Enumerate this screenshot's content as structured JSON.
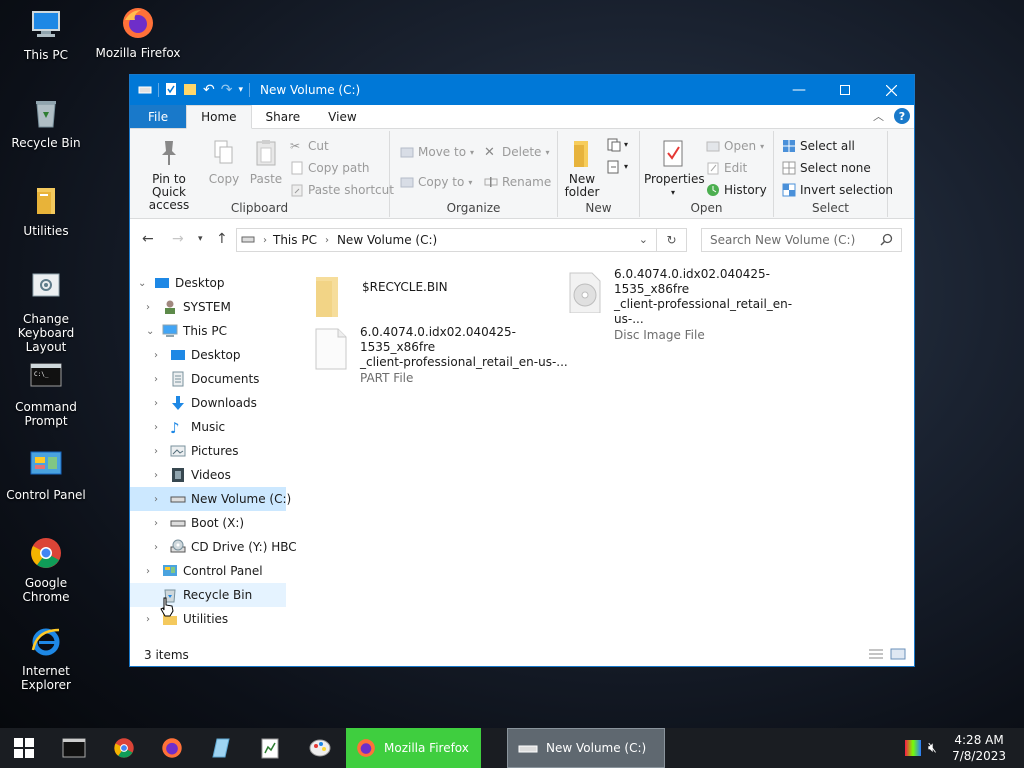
{
  "desktop": {
    "icons": [
      {
        "label": "This PC"
      },
      {
        "label": "Mozilla Firefox"
      },
      {
        "label": "Recycle Bin"
      },
      {
        "label": "Utilities"
      },
      {
        "label_line1": "Change",
        "label_line2": "Keyboard Layout"
      },
      {
        "label_line1": "Command",
        "label_line2": "Prompt"
      },
      {
        "label": "Control Panel"
      },
      {
        "label": "Google Chrome"
      },
      {
        "label": "Internet Explorer"
      }
    ]
  },
  "window": {
    "title": "New Volume (C:)",
    "tabs": {
      "file": "File",
      "home": "Home",
      "share": "Share",
      "view": "View"
    },
    "ribbon": {
      "clipboard": {
        "pin_line1": "Pin to Quick",
        "pin_line2": "access",
        "copy": "Copy",
        "paste": "Paste",
        "cut": "Cut",
        "copy_path": "Copy path",
        "paste_shortcut": "Paste shortcut",
        "label": "Clipboard"
      },
      "organize": {
        "move_to": "Move to",
        "copy_to": "Copy to",
        "delete": "Delete",
        "rename": "Rename",
        "label": "Organize"
      },
      "new": {
        "new_folder_line1": "New",
        "new_folder_line2": "folder",
        "label": "New"
      },
      "open": {
        "properties": "Properties",
        "open": "Open",
        "edit": "Edit",
        "history": "History",
        "label": "Open"
      },
      "select": {
        "select_all": "Select all",
        "select_none": "Select none",
        "invert": "Invert selection",
        "label": "Select"
      }
    },
    "address": {
      "crumbs": [
        "This PC",
        "New Volume (C:)"
      ]
    },
    "search": {
      "placeholder": "Search New Volume (C:)"
    },
    "tree": [
      {
        "label": "Desktop"
      },
      {
        "label": "SYSTEM"
      },
      {
        "label": "This PC"
      },
      {
        "label": "Desktop"
      },
      {
        "label": "Documents"
      },
      {
        "label": "Downloads"
      },
      {
        "label": "Music"
      },
      {
        "label": "Pictures"
      },
      {
        "label": "Videos"
      },
      {
        "label": "New Volume (C:)"
      },
      {
        "label": "Boot (X:)"
      },
      {
        "label": "CD Drive (Y:) HBC"
      },
      {
        "label": "Control Panel"
      },
      {
        "label": "Recycle Bin"
      },
      {
        "label": "Utilities"
      }
    ],
    "files": [
      {
        "name": "$RECYCLE.BIN"
      },
      {
        "name_line1": "6.0.4074.0.idx02.040425-1535_x86fre",
        "name_line2": "_client-professional_retail_en-us-...",
        "type": "Disc Image File"
      },
      {
        "name_line1": "6.0.4074.0.idx02.040425-1535_x86fre",
        "name_line2": "_client-professional_retail_en-us-...",
        "type": "PART File"
      }
    ],
    "status": {
      "count": "3 items"
    }
  },
  "taskbar": {
    "tasks": [
      {
        "label": "Mozilla Firefox",
        "color": "#3fce3f"
      },
      {
        "label": "New Volume (C:)",
        "color": "#5f6870"
      }
    ],
    "clock": {
      "time": "4:28 AM",
      "date": "7/8/2023"
    }
  },
  "colors": {
    "accent": "#0078d7",
    "selection": "#cce8ff"
  }
}
